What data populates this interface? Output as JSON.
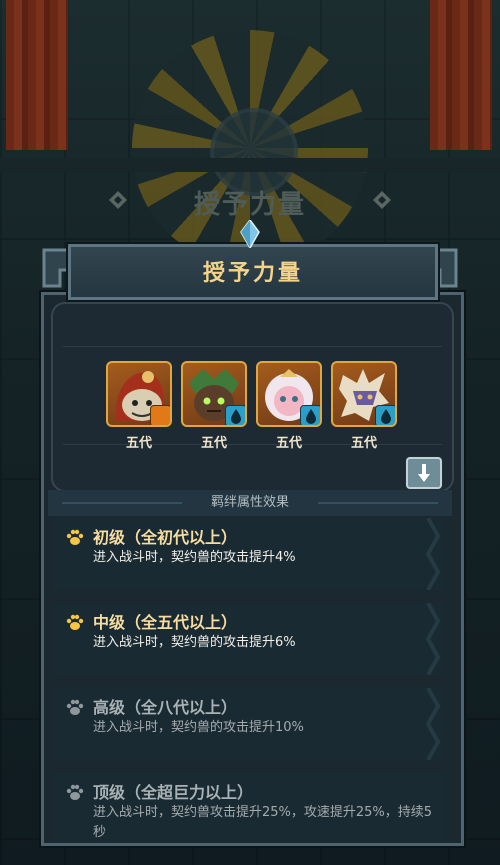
{
  "background": {
    "ghost_title": "授予力量"
  },
  "header": {
    "title": "授予力量"
  },
  "pets": [
    {
      "generation": "五代",
      "element_icon": "fire-badge-icon",
      "color": "#e07a18"
    },
    {
      "generation": "五代",
      "element_icon": "water-drop-icon",
      "color": "#2aa0c8"
    },
    {
      "generation": "五代",
      "element_icon": "water-drop-icon",
      "color": "#2aa0c8"
    },
    {
      "generation": "五代",
      "element_icon": "water-drop-icon",
      "color": "#2aa0c8"
    }
  ],
  "bond": {
    "header": "羁绊属性效果",
    "tiers": [
      {
        "title": "初级（全初代以上）",
        "desc": "进入战斗时，契约兽的攻击提升4%",
        "active": true
      },
      {
        "title": "中级（全五代以上）",
        "desc": "进入战斗时，契约兽的攻击提升6%",
        "active": true
      },
      {
        "title": "高级（全八代以上）",
        "desc": "进入战斗时，契约兽的攻击提升10%",
        "active": false
      },
      {
        "title": "顶级（全超巨力以上）",
        "desc": "进入战斗时，契约兽攻击提升25%，攻速提升25%，持续5秒",
        "active": false
      }
    ]
  },
  "colors": {
    "gold_text": "#f5d48a",
    "active_paw": "#f6c544",
    "locked_paw": "#8e979b",
    "water_badge": "#2aa0c8",
    "fire_badge": "#e07a18"
  }
}
